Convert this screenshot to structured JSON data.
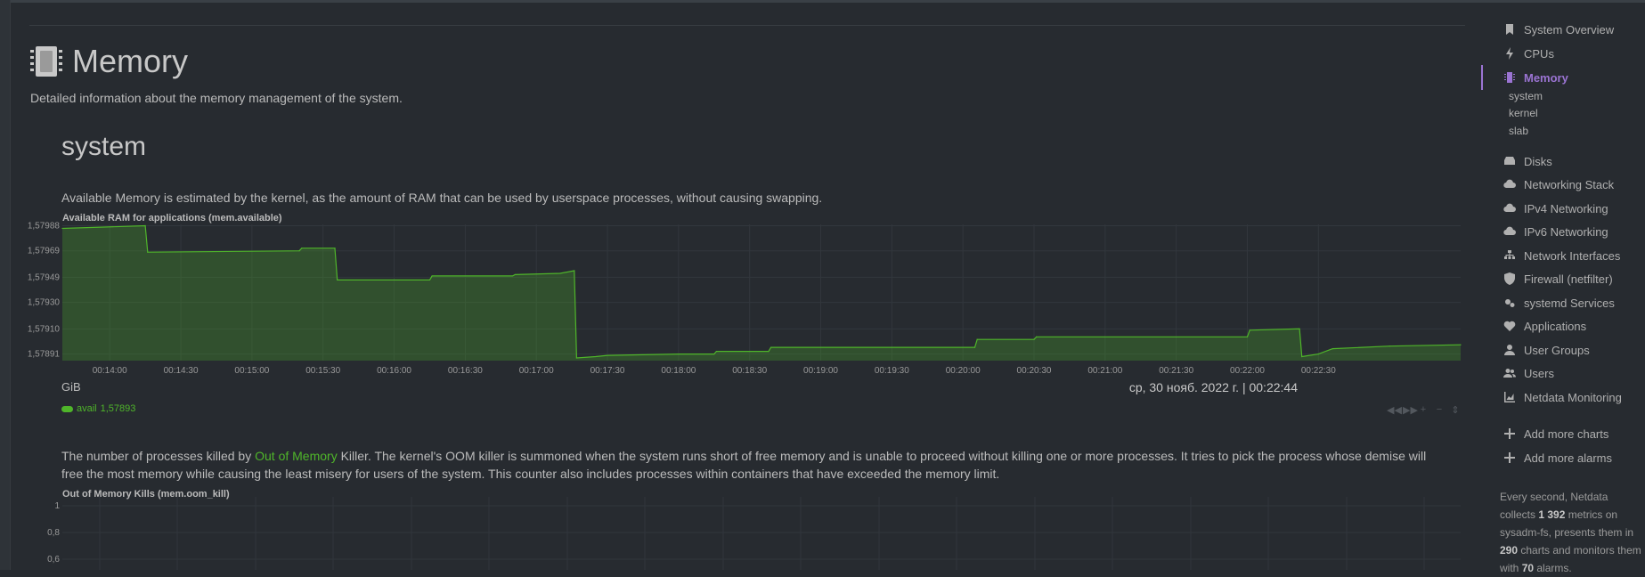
{
  "page": {
    "title": "Memory",
    "description": "Detailed information about the memory management of the system."
  },
  "section": {
    "title": "system"
  },
  "chart1": {
    "description": "Available Memory is estimated by the kernel, as the amount of RAM that can be used by userspace processes, without causing swapping.",
    "title": "Available RAM for applications (mem.available)",
    "unit": "GiB",
    "date": "ср, 30 нояб. 2022 г. | 00:22:44",
    "legend_label": "avail",
    "legend_value": "1,57893"
  },
  "chart2": {
    "desc_before": "The number of processes killed by ",
    "desc_link": "Out of Memory",
    "desc_after": " Killer. The kernel's OOM killer is summoned when the system runs short of free memory and is unable to proceed without killing one or more processes. It tries to pick the process whose demise will free the most memory while causing the least misery for users of the system. This counter also includes processes within containers that have exceeded the memory limit.",
    "title": "Out of Memory Kills (mem.oom_kill)"
  },
  "chart_data": [
    {
      "type": "area",
      "title": "Available RAM for applications (mem.available)",
      "ylabel": "GiB",
      "series": [
        {
          "name": "avail",
          "color": "#4fb52a"
        }
      ],
      "x_ticks": [
        "00:14:00",
        "00:14:30",
        "00:15:00",
        "00:15:30",
        "00:16:00",
        "00:16:30",
        "00:17:00",
        "00:17:30",
        "00:18:00",
        "00:18:30",
        "00:19:00",
        "00:19:30",
        "00:20:00",
        "00:20:30",
        "00:21:00",
        "00:21:30",
        "00:22:00",
        "00:22:30"
      ],
      "y_ticks": [
        "1,57988",
        "1,57969",
        "1,57949",
        "1,57930",
        "1,57910",
        "1,57891"
      ],
      "ylim": [
        1.57886,
        1.57989
      ],
      "points": [
        [
          "00:13:40",
          1.57986
        ],
        [
          "00:14:15",
          1.57988
        ],
        [
          "00:14:16",
          1.57968
        ],
        [
          "00:15:20",
          1.57969
        ],
        [
          "00:15:21",
          1.57971
        ],
        [
          "00:15:35",
          1.57971
        ],
        [
          "00:15:36",
          1.57947
        ],
        [
          "00:16:15",
          1.57947
        ],
        [
          "00:16:16",
          1.5795
        ],
        [
          "00:16:50",
          1.5795
        ],
        [
          "00:16:51",
          1.57951
        ],
        [
          "00:17:10",
          1.57952
        ],
        [
          "00:17:16",
          1.57954
        ],
        [
          "00:17:17",
          1.57888
        ],
        [
          "00:17:25",
          1.57889
        ],
        [
          "00:17:30",
          1.5789
        ],
        [
          "00:18:00",
          1.57891
        ],
        [
          "00:18:15",
          1.57891
        ],
        [
          "00:18:16",
          1.57893
        ],
        [
          "00:18:38",
          1.57893
        ],
        [
          "00:18:39",
          1.57896
        ],
        [
          "00:20:05",
          1.57896
        ],
        [
          "00:20:06",
          1.57902
        ],
        [
          "00:20:30",
          1.57902
        ],
        [
          "00:20:31",
          1.57904
        ],
        [
          "00:22:00",
          1.57904
        ],
        [
          "00:22:01",
          1.57909
        ],
        [
          "00:22:22",
          1.5791
        ],
        [
          "00:22:23",
          1.57889
        ],
        [
          "00:22:30",
          1.57891
        ],
        [
          "00:22:36",
          1.57895
        ],
        [
          "00:23:00",
          1.57897
        ],
        [
          "00:23:30",
          1.57898
        ]
      ]
    },
    {
      "type": "line",
      "title": "Out of Memory Kills (mem.oom_kill)",
      "y_ticks": [
        "1",
        "0,8",
        "0,6"
      ]
    }
  ],
  "sidebar": {
    "items": [
      {
        "label": "System Overview",
        "icon": "bookmark-icon"
      },
      {
        "label": "CPUs",
        "icon": "bolt-icon"
      },
      {
        "label": "Memory",
        "icon": "memory-chip-icon",
        "active": true
      },
      {
        "label": "Disks",
        "icon": "hdd-icon"
      },
      {
        "label": "Networking Stack",
        "icon": "cloud-icon"
      },
      {
        "label": "IPv4 Networking",
        "icon": "cloud-icon"
      },
      {
        "label": "IPv6 Networking",
        "icon": "cloud-icon"
      },
      {
        "label": "Network Interfaces",
        "icon": "sitemap-icon"
      },
      {
        "label": "Firewall (netfilter)",
        "icon": "shield-icon"
      },
      {
        "label": "systemd Services",
        "icon": "cogs-icon"
      },
      {
        "label": "Applications",
        "icon": "heartbeat-icon"
      },
      {
        "label": "User Groups",
        "icon": "user-icon"
      },
      {
        "label": "Users",
        "icon": "users-icon"
      },
      {
        "label": "Netdata Monitoring",
        "icon": "chart-area-icon"
      }
    ],
    "subitems": [
      "system",
      "kernel",
      "slab"
    ],
    "add_charts": "Add more charts",
    "add_alarms": "Add more alarms",
    "footer": {
      "t1": "Every second, Netdata collects ",
      "metrics": "1 392",
      "t2": " metrics on sysadm-fs, presents them in ",
      "charts": "290",
      "t3": " charts and monitors them with ",
      "alarms": "70",
      "t4": " alarms."
    }
  },
  "colors": {
    "accent": "#9b74d3",
    "series": "#4fb52a",
    "background": "#272b30"
  }
}
